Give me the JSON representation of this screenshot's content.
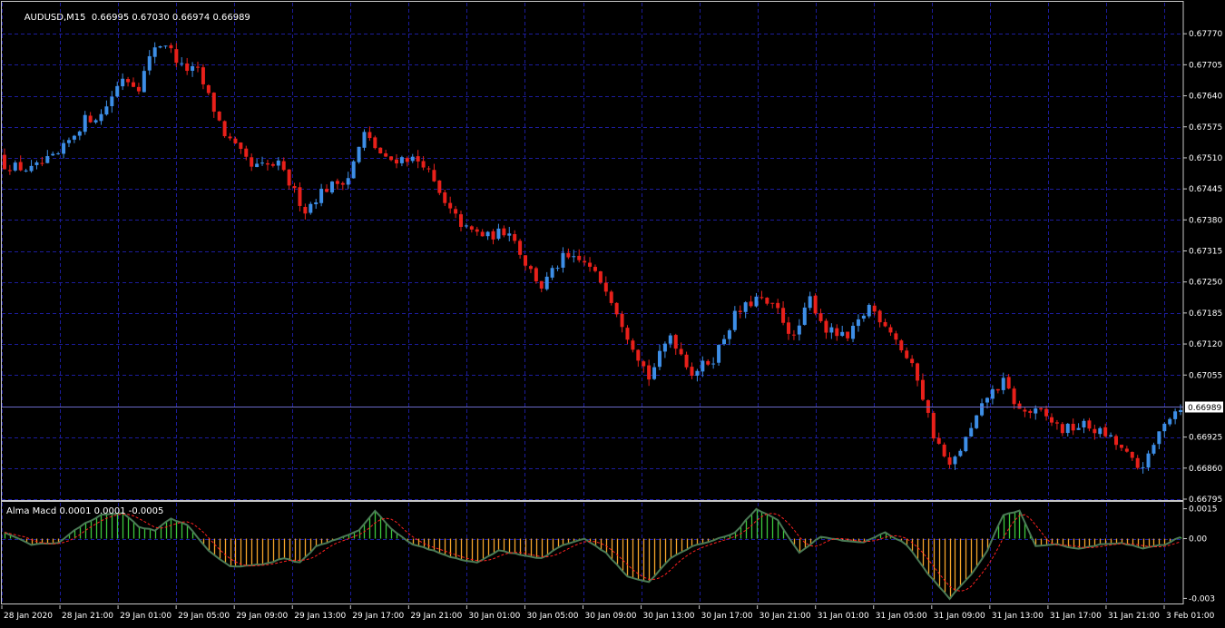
{
  "header": {
    "symbol": "AUDUSD,M15",
    "ohlc": "0.66995 0.67030 0.66974 0.66989",
    "indicator": "Alma Macd 0.0001 0.0001 -0.0005"
  },
  "colors": {
    "background": "#000000",
    "grid": "#1c1c9c",
    "bull": "#3d8ee6",
    "bear": "#e8201a",
    "hist_pos": "#3cc83c",
    "hist_neg": "#f5a52a",
    "macd_line": "#4a7a55",
    "signal_line": "#ff2020",
    "frame": "#c8c8c8"
  },
  "chart_data": [
    {
      "type": "candlestick",
      "title": "AUDUSD,M15",
      "ylim": [
        0.66795,
        0.67835
      ],
      "y_ticks": [
        "0.67770",
        "0.67705",
        "0.67640",
        "0.67575",
        "0.67510",
        "0.67445",
        "0.67380",
        "0.67315",
        "0.67250",
        "0.67185",
        "0.67120",
        "0.67055",
        "0.66925",
        "0.66860",
        "0.66795"
      ],
      "current_price": "0.66989",
      "x_labels": [
        "28 Jan 2020",
        "28 Jan 21:00",
        "29 Jan 01:00",
        "29 Jan 05:00",
        "29 Jan 09:00",
        "29 Jan 13:00",
        "29 Jan 17:00",
        "29 Jan 21:00",
        "30 Jan 01:00",
        "30 Jan 05:00",
        "30 Jan 09:00",
        "30 Jan 13:00",
        "30 Jan 17:00",
        "30 Jan 21:00",
        "31 Jan 01:00",
        "31 Jan 05:00",
        "31 Jan 09:00",
        "31 Jan 13:00",
        "31 Jan 17:00",
        "31 Jan 21:00",
        "3 Feb 01:00"
      ],
      "close_path": [
        {
          "x": 0,
          "y": 0.67495
        },
        {
          "x": 5,
          "y": 0.67485
        },
        {
          "x": 10,
          "y": 0.67515
        },
        {
          "x": 15,
          "y": 0.6759
        },
        {
          "x": 18,
          "y": 0.676
        },
        {
          "x": 22,
          "y": 0.6768
        },
        {
          "x": 25,
          "y": 0.6766
        },
        {
          "x": 28,
          "y": 0.67745
        },
        {
          "x": 30,
          "y": 0.6775
        },
        {
          "x": 33,
          "y": 0.677
        },
        {
          "x": 36,
          "y": 0.6769
        },
        {
          "x": 41,
          "y": 0.6756
        },
        {
          "x": 46,
          "y": 0.6749
        },
        {
          "x": 51,
          "y": 0.67495
        },
        {
          "x": 56,
          "y": 0.674
        },
        {
          "x": 59,
          "y": 0.6744
        },
        {
          "x": 64,
          "y": 0.6747
        },
        {
          "x": 67,
          "y": 0.6756
        },
        {
          "x": 71,
          "y": 0.67505
        },
        {
          "x": 75,
          "y": 0.6751
        },
        {
          "x": 78,
          "y": 0.675
        },
        {
          "x": 82,
          "y": 0.6741
        },
        {
          "x": 86,
          "y": 0.6736
        },
        {
          "x": 90,
          "y": 0.67345
        },
        {
          "x": 94,
          "y": 0.6736
        },
        {
          "x": 97,
          "y": 0.6729
        },
        {
          "x": 100,
          "y": 0.6724
        },
        {
          "x": 104,
          "y": 0.673
        },
        {
          "x": 108,
          "y": 0.6729
        },
        {
          "x": 112,
          "y": 0.6724
        },
        {
          "x": 116,
          "y": 0.6714
        },
        {
          "x": 120,
          "y": 0.6705
        },
        {
          "x": 124,
          "y": 0.6714
        },
        {
          "x": 128,
          "y": 0.6706
        },
        {
          "x": 132,
          "y": 0.6709
        },
        {
          "x": 136,
          "y": 0.6718
        },
        {
          "x": 140,
          "y": 0.67215
        },
        {
          "x": 144,
          "y": 0.6719
        },
        {
          "x": 147,
          "y": 0.6713
        },
        {
          "x": 150,
          "y": 0.67215
        },
        {
          "x": 153,
          "y": 0.6715
        },
        {
          "x": 157,
          "y": 0.6713
        },
        {
          "x": 161,
          "y": 0.672
        },
        {
          "x": 165,
          "y": 0.6715
        },
        {
          "x": 170,
          "y": 0.6705
        },
        {
          "x": 173,
          "y": 0.6693
        },
        {
          "x": 176,
          "y": 0.6686
        },
        {
          "x": 180,
          "y": 0.6694
        },
        {
          "x": 183,
          "y": 0.6701
        },
        {
          "x": 186,
          "y": 0.6704
        },
        {
          "x": 189,
          "y": 0.6698
        },
        {
          "x": 193,
          "y": 0.66975
        },
        {
          "x": 197,
          "y": 0.6694
        },
        {
          "x": 201,
          "y": 0.6695
        },
        {
          "x": 205,
          "y": 0.6693
        },
        {
          "x": 208,
          "y": 0.669
        },
        {
          "x": 211,
          "y": 0.6686
        },
        {
          "x": 213,
          "y": 0.6688
        },
        {
          "x": 216,
          "y": 0.6696
        },
        {
          "x": 219,
          "y": 0.6699
        }
      ]
    },
    {
      "type": "histogram",
      "title": "Alma Macd 0.0001 0.0001 -0.0005",
      "ylim": [
        -0.0033,
        0.0018
      ],
      "y_ticks": [
        "0.0015",
        "0.00",
        "-0.003"
      ],
      "hist_path": [
        {
          "x": 0,
          "y": 0.0003
        },
        {
          "x": 5,
          "y": -0.0003
        },
        {
          "x": 10,
          "y": -0.0002
        },
        {
          "x": 14,
          "y": 0.0006
        },
        {
          "x": 18,
          "y": 0.0012
        },
        {
          "x": 22,
          "y": 0.0013
        },
        {
          "x": 25,
          "y": 0.0006
        },
        {
          "x": 28,
          "y": 0.0004
        },
        {
          "x": 31,
          "y": 0.001
        },
        {
          "x": 34,
          "y": 0.0007
        },
        {
          "x": 38,
          "y": -0.0006
        },
        {
          "x": 42,
          "y": -0.0014
        },
        {
          "x": 48,
          "y": -0.0013
        },
        {
          "x": 52,
          "y": -0.001
        },
        {
          "x": 55,
          "y": -0.0012
        },
        {
          "x": 58,
          "y": -0.0004
        },
        {
          "x": 62,
          "y": 0.0
        },
        {
          "x": 66,
          "y": 0.0004
        },
        {
          "x": 69,
          "y": 0.0014
        },
        {
          "x": 72,
          "y": 0.0005
        },
        {
          "x": 76,
          "y": -0.0003
        },
        {
          "x": 80,
          "y": -0.0006
        },
        {
          "x": 84,
          "y": -0.001
        },
        {
          "x": 88,
          "y": -0.0012
        },
        {
          "x": 92,
          "y": -0.0006
        },
        {
          "x": 96,
          "y": -0.0008
        },
        {
          "x": 100,
          "y": -0.001
        },
        {
          "x": 104,
          "y": -0.0003
        },
        {
          "x": 108,
          "y": 0.0
        },
        {
          "x": 112,
          "y": -0.0007
        },
        {
          "x": 116,
          "y": -0.0019
        },
        {
          "x": 120,
          "y": -0.0022
        },
        {
          "x": 124,
          "y": -0.001
        },
        {
          "x": 128,
          "y": -0.0004
        },
        {
          "x": 132,
          "y": -0.0001
        },
        {
          "x": 136,
          "y": 0.0003
        },
        {
          "x": 140,
          "y": 0.0015
        },
        {
          "x": 144,
          "y": 0.0009
        },
        {
          "x": 148,
          "y": -0.0007
        },
        {
          "x": 152,
          "y": 0.0001
        },
        {
          "x": 156,
          "y": -0.0001
        },
        {
          "x": 160,
          "y": -0.0002
        },
        {
          "x": 164,
          "y": 0.0003
        },
        {
          "x": 168,
          "y": -0.0003
        },
        {
          "x": 172,
          "y": -0.0018
        },
        {
          "x": 176,
          "y": -0.003
        },
        {
          "x": 180,
          "y": -0.0018
        },
        {
          "x": 183,
          "y": -0.0006
        },
        {
          "x": 186,
          "y": 0.0012
        },
        {
          "x": 189,
          "y": 0.0014
        },
        {
          "x": 192,
          "y": -0.0004
        },
        {
          "x": 196,
          "y": -0.0003
        },
        {
          "x": 200,
          "y": -0.0005
        },
        {
          "x": 204,
          "y": -0.0003
        },
        {
          "x": 208,
          "y": -0.0002
        },
        {
          "x": 212,
          "y": -0.0005
        },
        {
          "x": 216,
          "y": -0.0003
        },
        {
          "x": 219,
          "y": 0.0001
        }
      ]
    }
  ]
}
